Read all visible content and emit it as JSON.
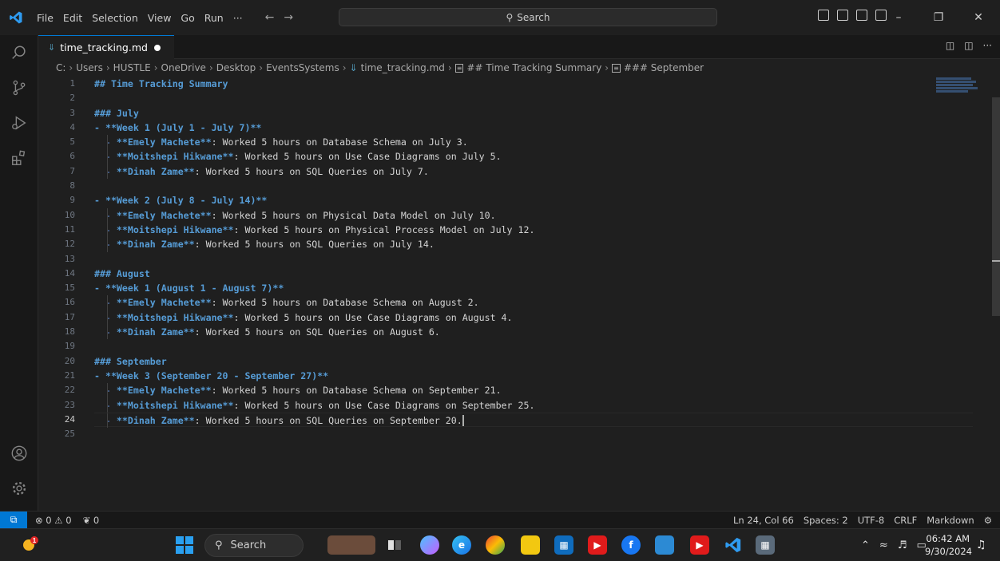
{
  "menu": [
    "File",
    "Edit",
    "Selection",
    "View",
    "Go",
    "Run",
    "···"
  ],
  "search": {
    "label": "Search"
  },
  "tab": {
    "filename": "time_tracking.md"
  },
  "breadcrumb": [
    "C:",
    "Users",
    "HUSTLE",
    "OneDrive",
    "Desktop",
    "EventsSystems",
    "time_tracking.md",
    "## Time Tracking Summary",
    "### September"
  ],
  "editor": {
    "active_line": 24,
    "lines": [
      {
        "n": "1",
        "text": "## Time Tracking Summary",
        "kind": "heading"
      },
      {
        "n": "2",
        "text": "",
        "kind": "blank"
      },
      {
        "n": "3",
        "text": "### July",
        "kind": "heading"
      },
      {
        "n": "4",
        "text": "- **Week 1 (July 1 - July 7)**",
        "kind": "week"
      },
      {
        "n": "5",
        "bold": "**Emely Machete**",
        "text": ": Worked 5 hours on Database Schema on July 3.",
        "kind": "entry"
      },
      {
        "n": "6",
        "bold": "**Moitshepi Hikwane**",
        "text": ": Worked 5 hours on Use Case Diagrams on July 5.",
        "kind": "entry"
      },
      {
        "n": "7",
        "bold": "**Dinah Zame**",
        "text": ": Worked 5 hours on SQL Queries on July 7.",
        "kind": "entry"
      },
      {
        "n": "8",
        "text": "",
        "kind": "blank"
      },
      {
        "n": "9",
        "text": "- **Week 2 (July 8 - July 14)**",
        "kind": "week"
      },
      {
        "n": "10",
        "bold": "**Emely Machete**",
        "text": ": Worked 5 hours on Physical Data Model on July 10.",
        "kind": "entry"
      },
      {
        "n": "11",
        "bold": "**Moitshepi Hikwane**",
        "text": ": Worked 5 hours on Physical Process Model on July 12.",
        "kind": "entry"
      },
      {
        "n": "12",
        "bold": "**Dinah Zame**",
        "text": ": Worked 5 hours on SQL Queries on July 14.",
        "kind": "entry"
      },
      {
        "n": "13",
        "text": "",
        "kind": "blank"
      },
      {
        "n": "14",
        "text": "### August",
        "kind": "heading"
      },
      {
        "n": "15",
        "text": "- **Week 1 (August 1 - August 7)**",
        "kind": "week"
      },
      {
        "n": "16",
        "bold": "**Emely Machete**",
        "text": ": Worked 5 hours on Database Schema on August 2.",
        "kind": "entry"
      },
      {
        "n": "17",
        "bold": "**Moitshepi Hikwane**",
        "text": ": Worked 5 hours on Use Case Diagrams on August 4.",
        "kind": "entry"
      },
      {
        "n": "18",
        "bold": "**Dinah Zame**",
        "text": ": Worked 5 hours on SQL Queries on August 6.",
        "kind": "entry"
      },
      {
        "n": "19",
        "text": "",
        "kind": "blank"
      },
      {
        "n": "20",
        "text": "### September",
        "kind": "heading"
      },
      {
        "n": "21",
        "text": "- **Week 3 (September 20 - September 27)**",
        "kind": "week"
      },
      {
        "n": "22",
        "bold": "**Emely Machete**",
        "text": ": Worked 5 hours on Database Schema on September 21.",
        "kind": "entry"
      },
      {
        "n": "23",
        "bold": "**Moitshepi Hikwane**",
        "text": ": Worked 5 hours on Use Case Diagrams on September 25.",
        "kind": "entry"
      },
      {
        "n": "24",
        "bold": "**Dinah Zame**",
        "text": ": Worked 5 hours on SQL Queries on September 20.",
        "kind": "entry"
      },
      {
        "n": "25",
        "text": "",
        "kind": "blank"
      }
    ]
  },
  "status": {
    "errors": "0",
    "warnings": "0",
    "ports": "0",
    "position": "Ln 24, Col 66",
    "spaces": "Spaces: 2",
    "encoding": "UTF-8",
    "eol": "CRLF",
    "language": "Markdown"
  },
  "taskbar": {
    "search": "Search",
    "time": "06:42 AM",
    "date": "9/30/2024",
    "notification_count": "1"
  },
  "colors": {
    "accent": "#0078d4",
    "heading": "#569cd6",
    "background": "#1f1f1f"
  }
}
